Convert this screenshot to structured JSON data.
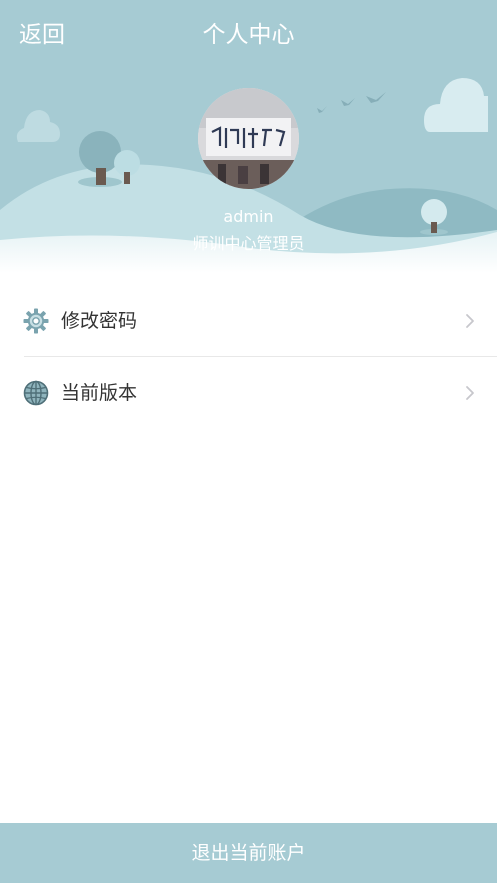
{
  "header": {
    "back_label": "返回",
    "title": "个人中心",
    "username": "admin",
    "role": "师训中心管理员"
  },
  "menu": {
    "items": [
      {
        "label": "修改密码",
        "icon": "gear-icon"
      },
      {
        "label": "当前版本",
        "icon": "globe-icon"
      }
    ]
  },
  "footer": {
    "logout_label": "退出当前账户"
  },
  "colors": {
    "header_bg": "#a6cbd3",
    "accent": "#a6cbd3",
    "text": "#333333",
    "chevron": "#c7c7cc"
  }
}
